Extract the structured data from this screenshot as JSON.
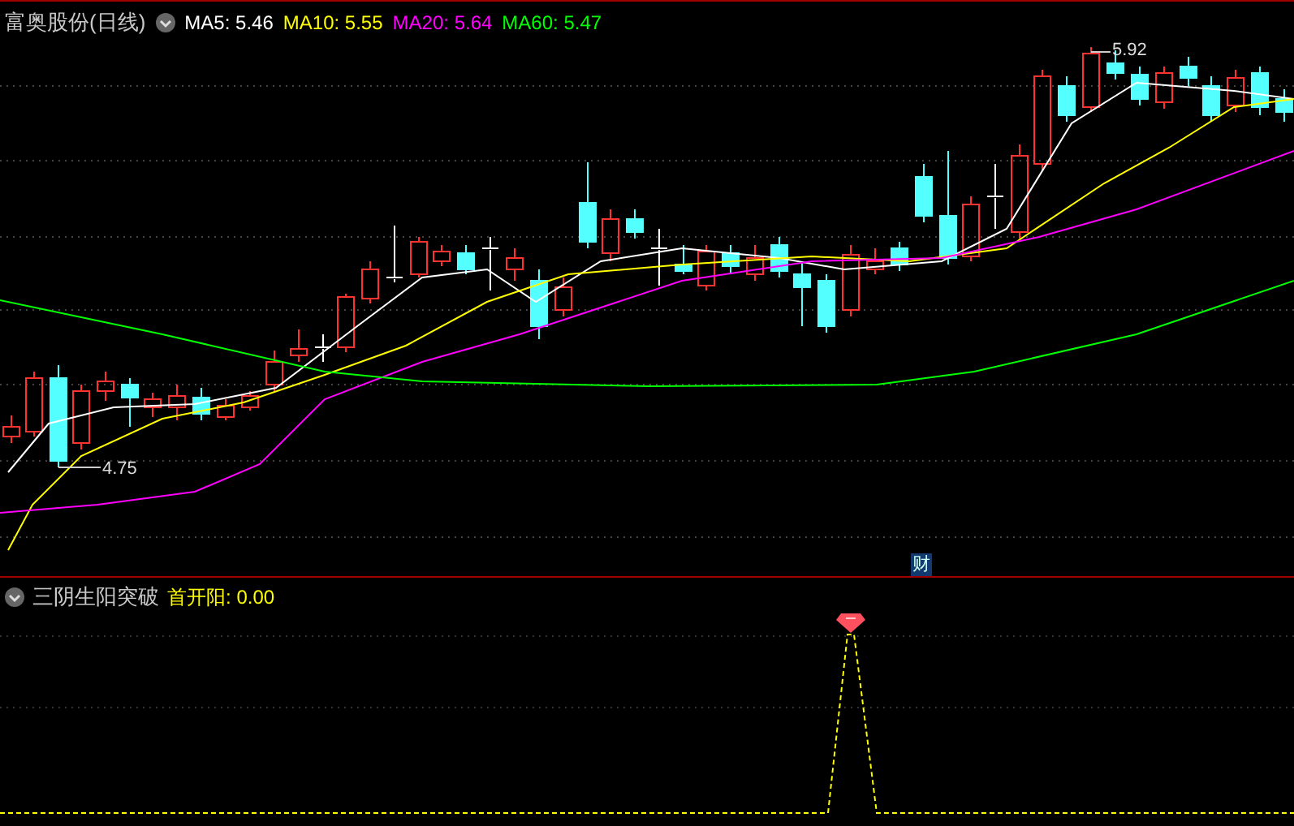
{
  "main_panel": {
    "title": "富奥股份(日线)",
    "moving_averages": [
      {
        "label": "MA5:",
        "value": "5.46",
        "color": "#ffffff"
      },
      {
        "label": "MA10:",
        "value": "5.55",
        "color": "#ffff00"
      },
      {
        "label": "MA20:",
        "value": "5.64",
        "color": "#ff00ff"
      },
      {
        "label": "MA60:",
        "value": "5.47",
        "color": "#00ff00"
      }
    ],
    "high_label": "5.92",
    "low_label": "4.75",
    "finance_badge": "财"
  },
  "indicator_panel": {
    "title": "三阴生阳突破",
    "lines": [
      {
        "label": "首开阳:",
        "value": "0.00",
        "color": "#ffff00"
      }
    ]
  }
}
